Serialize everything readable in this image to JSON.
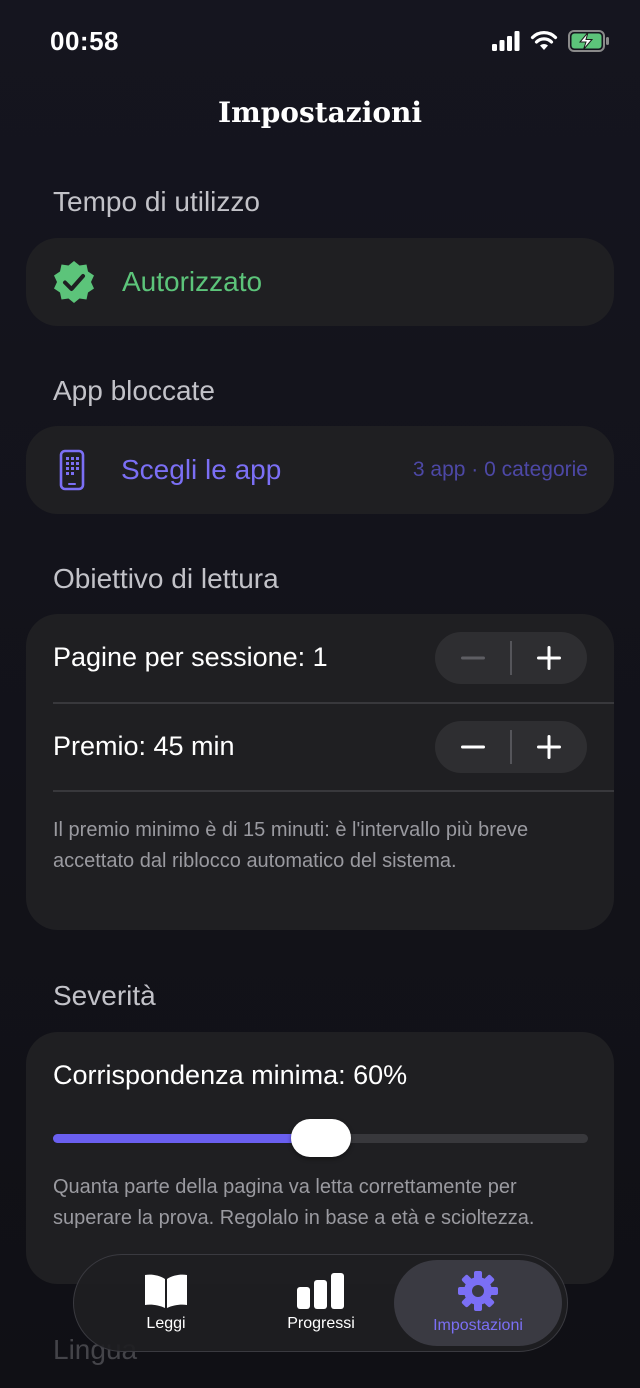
{
  "status_bar": {
    "time": "00:58",
    "icons": [
      "signal-icon",
      "wifi-icon",
      "battery-charging-icon"
    ],
    "battery_color": "#5cc47a"
  },
  "header": {
    "title": "Impostazioni"
  },
  "screen_time": {
    "section_title": "Tempo di utilizzo",
    "status_label": "Autorizzato",
    "status_icon": "verified-badge-icon",
    "status_color": "#5cc47a"
  },
  "blocked_apps": {
    "section_title": "App bloccate",
    "choose_label": "Scegli le app",
    "choose_icon": "phone-grid-icon",
    "summary": "3 app · 0 categorie",
    "accent_color": "#7b6ff5"
  },
  "reading_goal": {
    "section_title": "Obiettivo di lettura",
    "pages_label": "Pagine per sessione: 1",
    "pages_value": 1,
    "reward_label": "Premio: 45 min",
    "reward_minutes": 45,
    "note": "Il premio minimo è di 15 minuti: è l'intervallo più breve accettato dal riblocco automatico del sistema."
  },
  "severity": {
    "section_title": "Severità",
    "match_label": "Corrispondenza minima: 60%",
    "match_percent": 60,
    "slider_fill_fraction": 0.5,
    "note": "Quanta parte della pagina va letta correttamente per superare la prova. Regolalo in base a età e scioltezza."
  },
  "language": {
    "section_title": "Lingua"
  },
  "tab_bar": {
    "tabs": [
      {
        "label": "Leggi",
        "icon": "book-icon",
        "active": false
      },
      {
        "label": "Progressi",
        "icon": "bar-chart-icon",
        "active": false
      },
      {
        "label": "Impostazioni",
        "icon": "gear-icon",
        "active": true
      }
    ],
    "active_color": "#7b6ff5"
  }
}
